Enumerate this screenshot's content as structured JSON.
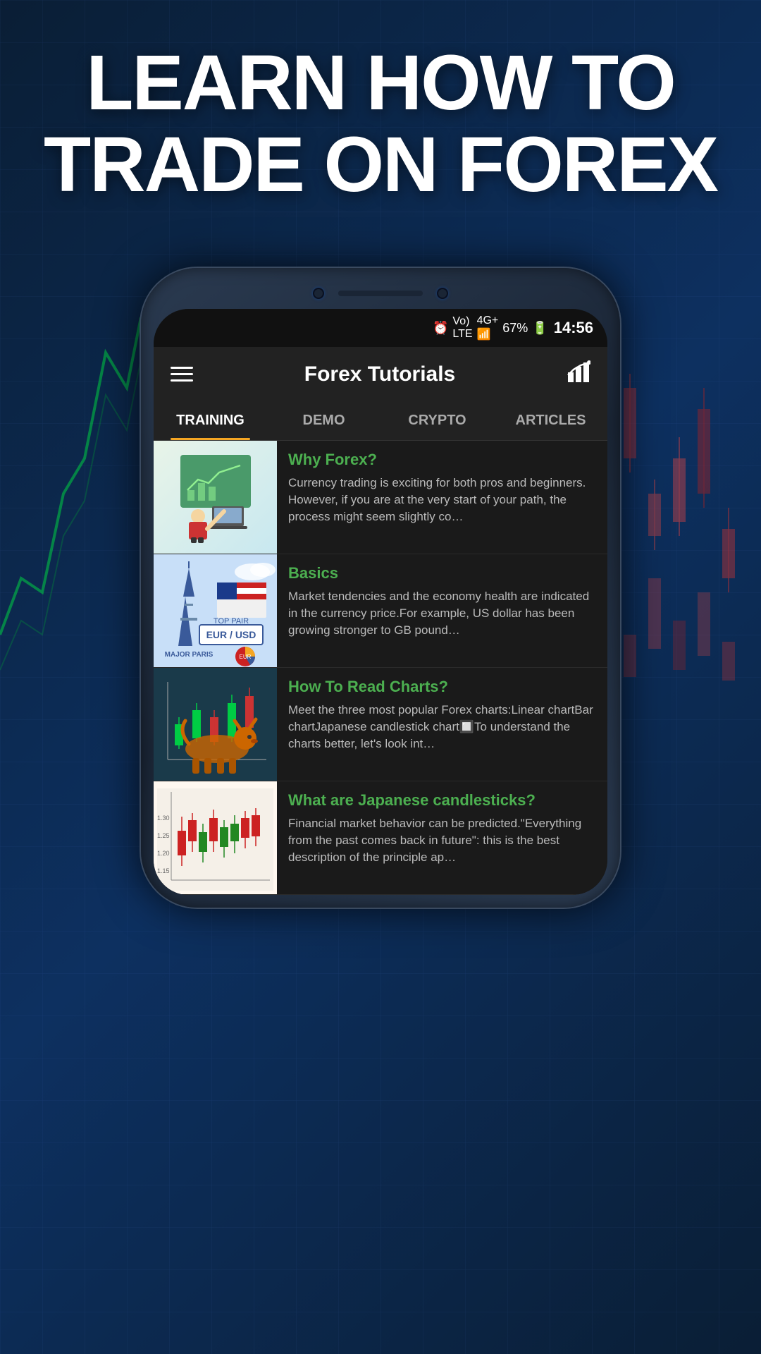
{
  "hero": {
    "title_line1": "LEARN HOW TO",
    "title_line2": "TRADE ON FOREX"
  },
  "status_bar": {
    "alarm_icon": "⏰",
    "signal": "Vo) 4G+",
    "battery": "67%",
    "time": "14:56"
  },
  "header": {
    "title": "Forex Tutorials",
    "chart_icon": "📈"
  },
  "tabs": [
    {
      "label": "TRAINING",
      "active": true
    },
    {
      "label": "DEMO",
      "active": false
    },
    {
      "label": "CRYPTO",
      "active": false
    },
    {
      "label": "ARTICLES",
      "active": false
    }
  ],
  "articles": [
    {
      "title": "Why Forex?",
      "excerpt": "Currency trading is exciting for both pros and beginners. However, if you are at the very start of your path, the process might seem slightly co…",
      "thumb_type": "why-forex"
    },
    {
      "title": "Basics",
      "excerpt": "Market tendencies and the economy health are indicated in the currency price.For example, US dollar has been growing stronger to GB pound…",
      "thumb_type": "basics"
    },
    {
      "title": "How To Read Charts?",
      "excerpt": "Meet the three most popular Forex charts:Linear chartBar chartJapanese candlestick chart🔲To understand the charts better, let's look int…",
      "thumb_type": "charts"
    },
    {
      "title": "What are Japanese candlesticks?",
      "excerpt": "Financial market behavior can be predicted.\"Everything from the past comes back in future\": this is the best description of the principle ap…",
      "thumb_type": "candlesticks"
    }
  ],
  "colors": {
    "accent_green": "#4CAF50",
    "accent_orange": "#f5a623",
    "bg_dark": "#1a1a1a",
    "header_bg": "#222222"
  }
}
